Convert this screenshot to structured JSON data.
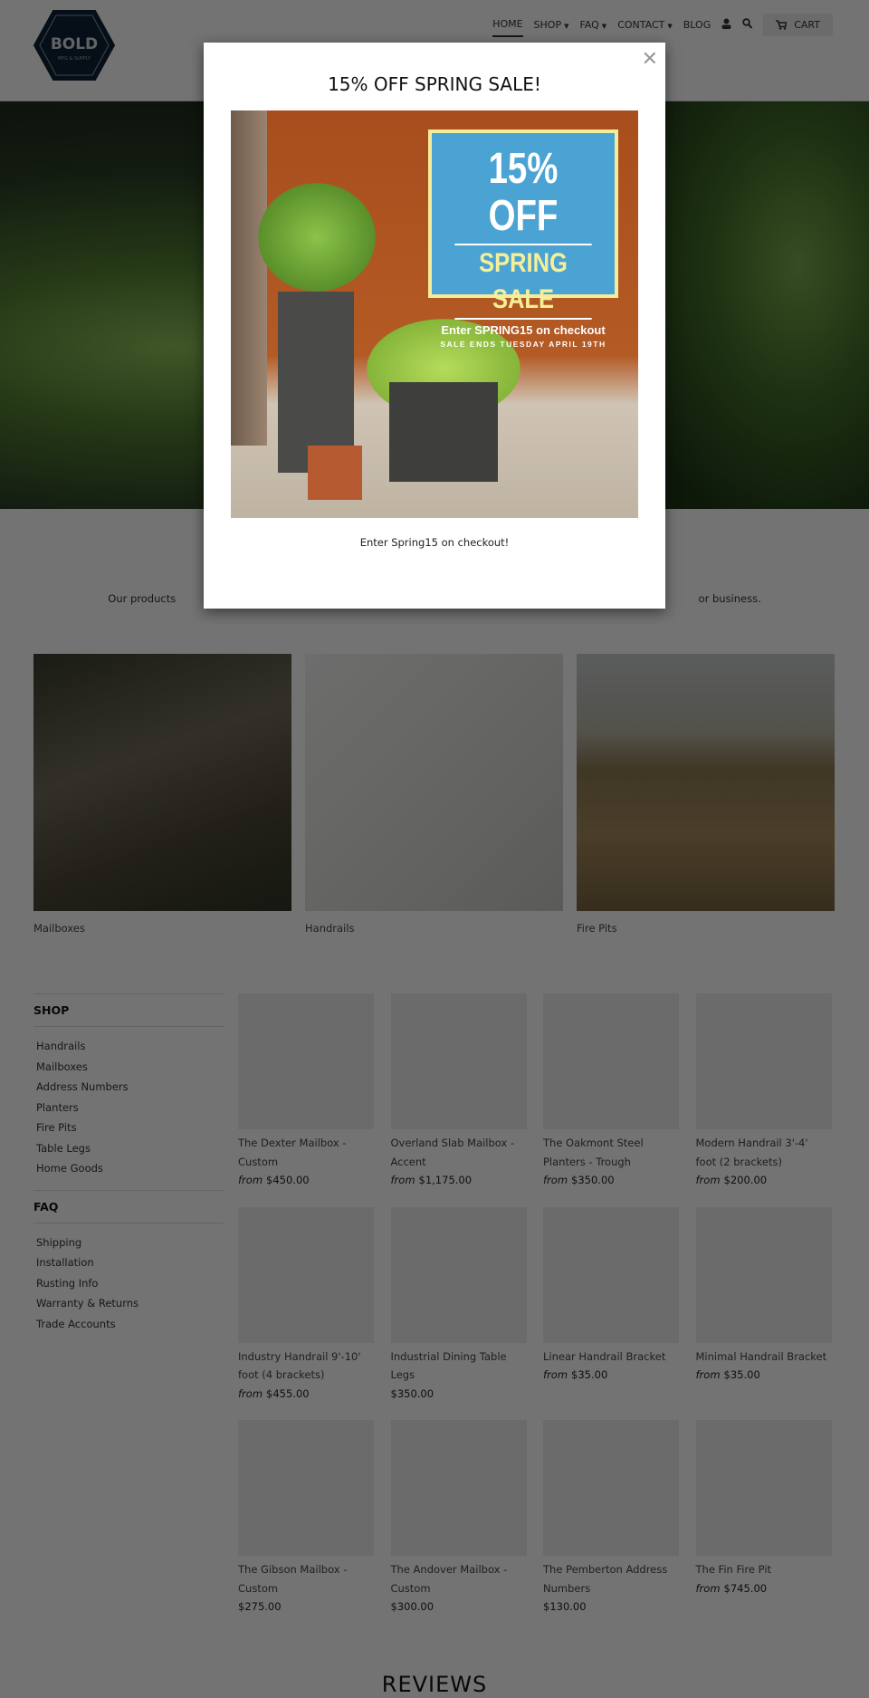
{
  "header": {
    "logo": {
      "title": "BOLD",
      "subtitle": "MFG & SUPPLY"
    },
    "nav": [
      {
        "label": "HOME",
        "active": true
      },
      {
        "label": "SHOP",
        "dropdown": true
      },
      {
        "label": "FAQ",
        "dropdown": true
      },
      {
        "label": "CONTACT",
        "dropdown": true
      },
      {
        "label": "BLOG"
      }
    ],
    "icons": [
      "user-icon",
      "search-icon",
      "cart-icon"
    ],
    "cart_label": "CART"
  },
  "intro": {
    "left": "Our products",
    "right": "or business."
  },
  "categories": [
    {
      "label": "Mailboxes"
    },
    {
      "label": "Handrails"
    },
    {
      "label": "Fire Pits"
    }
  ],
  "sidebar": {
    "shop_heading": "SHOP",
    "shop_items": [
      "Handrails",
      "Mailboxes",
      "Address Numbers",
      "Planters",
      "Fire Pits",
      "Table Legs",
      "Home Goods"
    ],
    "faq_heading": "FAQ",
    "faq_items": [
      "Shipping",
      "Installation",
      "Rusting Info",
      "Warranty & Returns",
      "Trade Accounts"
    ]
  },
  "products": [
    {
      "title": "The Dexter Mailbox - Custom",
      "from": "from",
      "price": "$450.00"
    },
    {
      "title": "Overland Slab Mailbox - Accent",
      "from": "from",
      "price": "$1,175.00"
    },
    {
      "title": "The Oakmont Steel Planters - Trough",
      "from": "from",
      "price": "$350.00"
    },
    {
      "title": "Modern Handrail 3'-4' foot (2 brackets)",
      "from": "from",
      "price": "$200.00"
    },
    {
      "title": "Industry Handrail 9'-10' foot (4 brackets)",
      "from": "from",
      "price": "$455.00"
    },
    {
      "title": "Industrial Dining Table Legs",
      "from": "",
      "price": "$350.00"
    },
    {
      "title": "Linear Handrail Bracket",
      "from": "from",
      "price": "$35.00"
    },
    {
      "title": "Minimal Handrail Bracket",
      "from": "from",
      "price": "$35.00"
    },
    {
      "title": "The Gibson Mailbox - Custom",
      "from": "",
      "price": "$275.00"
    },
    {
      "title": "The Andover Mailbox - Custom",
      "from": "",
      "price": "$300.00"
    },
    {
      "title": "The Pemberton Address Numbers",
      "from": "",
      "price": "$130.00"
    },
    {
      "title": "The Fin Fire Pit",
      "from": "from",
      "price": "$745.00"
    }
  ],
  "reviews_heading": "REVIEWS",
  "modal": {
    "title": "15% OFF SPRING SALE!",
    "close_icon": "close-icon",
    "promo": {
      "headline": "15% OFF",
      "subhead": "SPRING SALE",
      "code_line": "Enter SPRING15 on checkout",
      "ends": "SALE ENDS TUESDAY APRIL 19TH"
    },
    "text": "Enter Spring15 on checkout!"
  },
  "colors": {
    "overlay": "#000000",
    "promo_blue": "#4ba3d3",
    "promo_yellow": "#f3ed9b",
    "logo_navy": "#0d2236"
  }
}
